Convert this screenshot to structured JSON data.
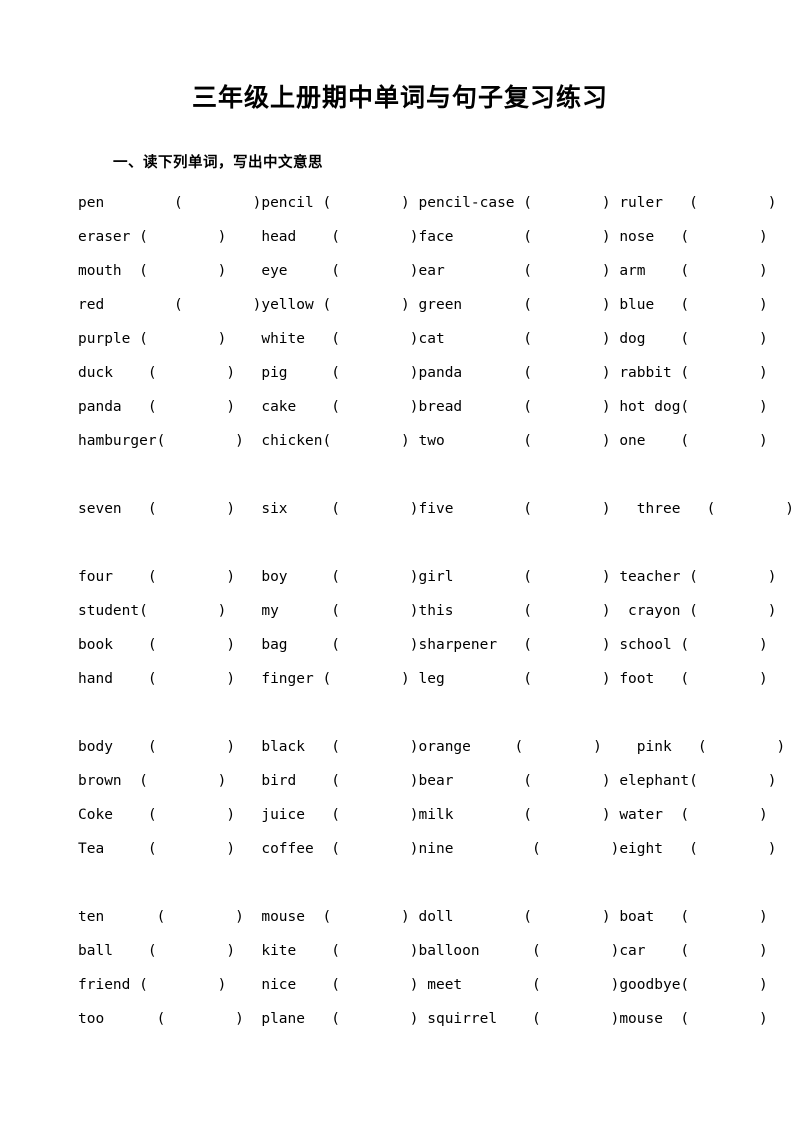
{
  "document": {
    "title": "三年级上册期中单词与句子复习练习",
    "section_heading": "一、读下列单词，写出中文意思",
    "blank": "（        ）"
  },
  "rows": [
    {
      "type": "words",
      "cells": [
        {
          "word": "pen",
          "gap": 8
        },
        {
          "word": "pencil",
          "gap": 1
        },
        {
          "word": "pencil-case",
          "gap": 1
        },
        {
          "word": "ruler",
          "gap": 3
        }
      ]
    },
    {
      "type": "words",
      "cells": [
        {
          "word": "eraser",
          "gap": 1
        },
        {
          "word": "head",
          "gap": 4
        },
        {
          "word": "face",
          "gap": 8
        },
        {
          "word": "nose",
          "gap": 3
        }
      ]
    },
    {
      "type": "words",
      "cells": [
        {
          "word": "mouth",
          "gap": 2
        },
        {
          "word": "eye",
          "gap": 5
        },
        {
          "word": "ear",
          "gap": 9
        },
        {
          "word": "arm",
          "gap": 4
        }
      ]
    },
    {
      "type": "words",
      "cells": [
        {
          "word": "red",
          "gap": 8
        },
        {
          "word": "yellow",
          "gap": 1
        },
        {
          "word": "green",
          "gap": 7
        },
        {
          "word": "blue",
          "gap": 3
        }
      ]
    },
    {
      "type": "words",
      "cells": [
        {
          "word": "purple",
          "gap": 1
        },
        {
          "word": "white",
          "gap": 3
        },
        {
          "word": "cat",
          "gap": 9
        },
        {
          "word": "dog",
          "gap": 4
        }
      ]
    },
    {
      "type": "words",
      "cells": [
        {
          "word": "duck",
          "gap": 4
        },
        {
          "word": "pig",
          "gap": 5
        },
        {
          "word": "panda",
          "gap": 7
        },
        {
          "word": "rabbit",
          "gap": 1
        }
      ]
    },
    {
      "type": "words",
      "cells": [
        {
          "word": "panda",
          "gap": 3
        },
        {
          "word": "cake",
          "gap": 4
        },
        {
          "word": "bread",
          "gap": 7
        },
        {
          "word": "hot dog",
          "gap": 0
        }
      ]
    },
    {
      "type": "words",
      "cells": [
        {
          "word": "hamburger",
          "gap": 0
        },
        {
          "word": "chicken",
          "gap": 0
        },
        {
          "word": "two",
          "gap": 9
        },
        {
          "word": "one",
          "gap": 4
        }
      ]
    },
    {
      "type": "spacer"
    },
    {
      "type": "words",
      "cells": [
        {
          "word": "seven",
          "gap": 3
        },
        {
          "word": "six",
          "gap": 5
        },
        {
          "word": "five",
          "gap": 8
        },
        {
          "word": "three",
          "gap": 3,
          "indent": 2
        }
      ]
    },
    {
      "type": "spacer"
    },
    {
      "type": "words",
      "cells": [
        {
          "word": "four",
          "gap": 4
        },
        {
          "word": "boy",
          "gap": 5
        },
        {
          "word": "girl",
          "gap": 8
        },
        {
          "word": "teacher",
          "gap": 1
        }
      ]
    },
    {
      "type": "words",
      "cells": [
        {
          "word": "student",
          "gap": 0
        },
        {
          "word": "my",
          "gap": 6
        },
        {
          "word": "this",
          "gap": 8
        },
        {
          "word": "crayon",
          "gap": 1,
          "indent": 1
        }
      ]
    },
    {
      "type": "words",
      "cells": [
        {
          "word": "book",
          "gap": 4
        },
        {
          "word": "bag",
          "gap": 5
        },
        {
          "word": "sharpener",
          "gap": 3
        },
        {
          "word": "school",
          "gap": 1
        }
      ]
    },
    {
      "type": "words",
      "cells": [
        {
          "word": "hand",
          "gap": 4
        },
        {
          "word": "finger",
          "gap": 1
        },
        {
          "word": "leg",
          "gap": 9
        },
        {
          "word": "foot",
          "gap": 3
        }
      ]
    },
    {
      "type": "spacer"
    },
    {
      "type": "words",
      "cells": [
        {
          "word": "body",
          "gap": 4
        },
        {
          "word": "black",
          "gap": 3
        },
        {
          "word": "orange",
          "gap": 5
        },
        {
          "word": "pink",
          "gap": 3,
          "indent": 2
        }
      ]
    },
    {
      "type": "words",
      "cells": [
        {
          "word": "brown",
          "gap": 2
        },
        {
          "word": "bird",
          "gap": 4
        },
        {
          "word": "bear",
          "gap": 8
        },
        {
          "word": "elephant",
          "gap": 0
        }
      ]
    },
    {
      "type": "words",
      "cells": [
        {
          "word": "Coke",
          "gap": 4
        },
        {
          "word": "juice",
          "gap": 3
        },
        {
          "word": "milk",
          "gap": 8
        },
        {
          "word": "water",
          "gap": 2
        }
      ]
    },
    {
      "type": "words",
      "cells": [
        {
          "word": "Tea",
          "gap": 5
        },
        {
          "word": "coffee",
          "gap": 2
        },
        {
          "word": "nine",
          "gap": 9
        },
        {
          "word": "eight",
          "gap": 3
        }
      ]
    },
    {
      "type": "spacer"
    },
    {
      "type": "words",
      "cells": [
        {
          "word": "ten",
          "gap": 6
        },
        {
          "word": "mouse",
          "gap": 2
        },
        {
          "word": "doll",
          "gap": 8
        },
        {
          "word": "boat",
          "gap": 3
        }
      ]
    },
    {
      "type": "words",
      "cells": [
        {
          "word": "ball",
          "gap": 4
        },
        {
          "word": "kite",
          "gap": 4
        },
        {
          "word": "balloon",
          "gap": 6
        },
        {
          "word": "car",
          "gap": 4
        }
      ]
    },
    {
      "type": "words",
      "cells": [
        {
          "word": "friend",
          "gap": 1
        },
        {
          "word": "nice",
          "gap": 4
        },
        {
          "word": "meet",
          "gap": 8,
          "indent": 1
        },
        {
          "word": "goodbye",
          "gap": 0
        }
      ]
    },
    {
      "type": "words",
      "cells": [
        {
          "word": "too",
          "gap": 6
        },
        {
          "word": "plane",
          "gap": 3
        },
        {
          "word": "squirrel",
          "gap": 4,
          "indent": 1
        },
        {
          "word": "mouse",
          "gap": 2
        }
      ]
    }
  ]
}
